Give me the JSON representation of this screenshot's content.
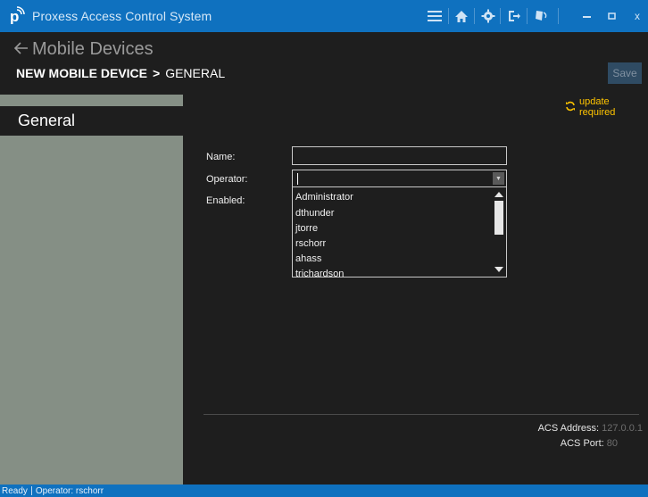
{
  "window": {
    "title": "Proxess Access Control System",
    "icons": [
      "menu-icon",
      "home-icon",
      "gear-icon",
      "logout-icon",
      "id-card-icon",
      "minimize-icon",
      "maximize-icon",
      "close-icon"
    ],
    "close_glyph": "x",
    "accent_color": "#0f71bf"
  },
  "header": {
    "back_label": "Mobile Devices",
    "breadcrumb_strong": "NEW MOBILE DEVICE",
    "breadcrumb_sep": ">",
    "breadcrumb_current": "GENERAL",
    "save_label": "Save"
  },
  "sidebar": {
    "items": [
      {
        "label": "General",
        "selected": true
      }
    ]
  },
  "notice": {
    "update_required": "update required",
    "color": "#ffc400"
  },
  "form": {
    "name_label": "Name:",
    "name_value": "",
    "operator_label": "Operator:",
    "operator_value": "",
    "enabled_label": "Enabled:",
    "operator_options": [
      "Administrator",
      "dthunder",
      "jtorre",
      "rschorr",
      "ahass",
      "trichardson"
    ]
  },
  "info": {
    "acs_address_label": "ACS Address:",
    "acs_address_value": "127.0.0.1",
    "acs_port_label": "ACS Port:",
    "acs_port_value": "80"
  },
  "status": {
    "state": "Ready",
    "operator_text": "Operator:  rschorr"
  }
}
